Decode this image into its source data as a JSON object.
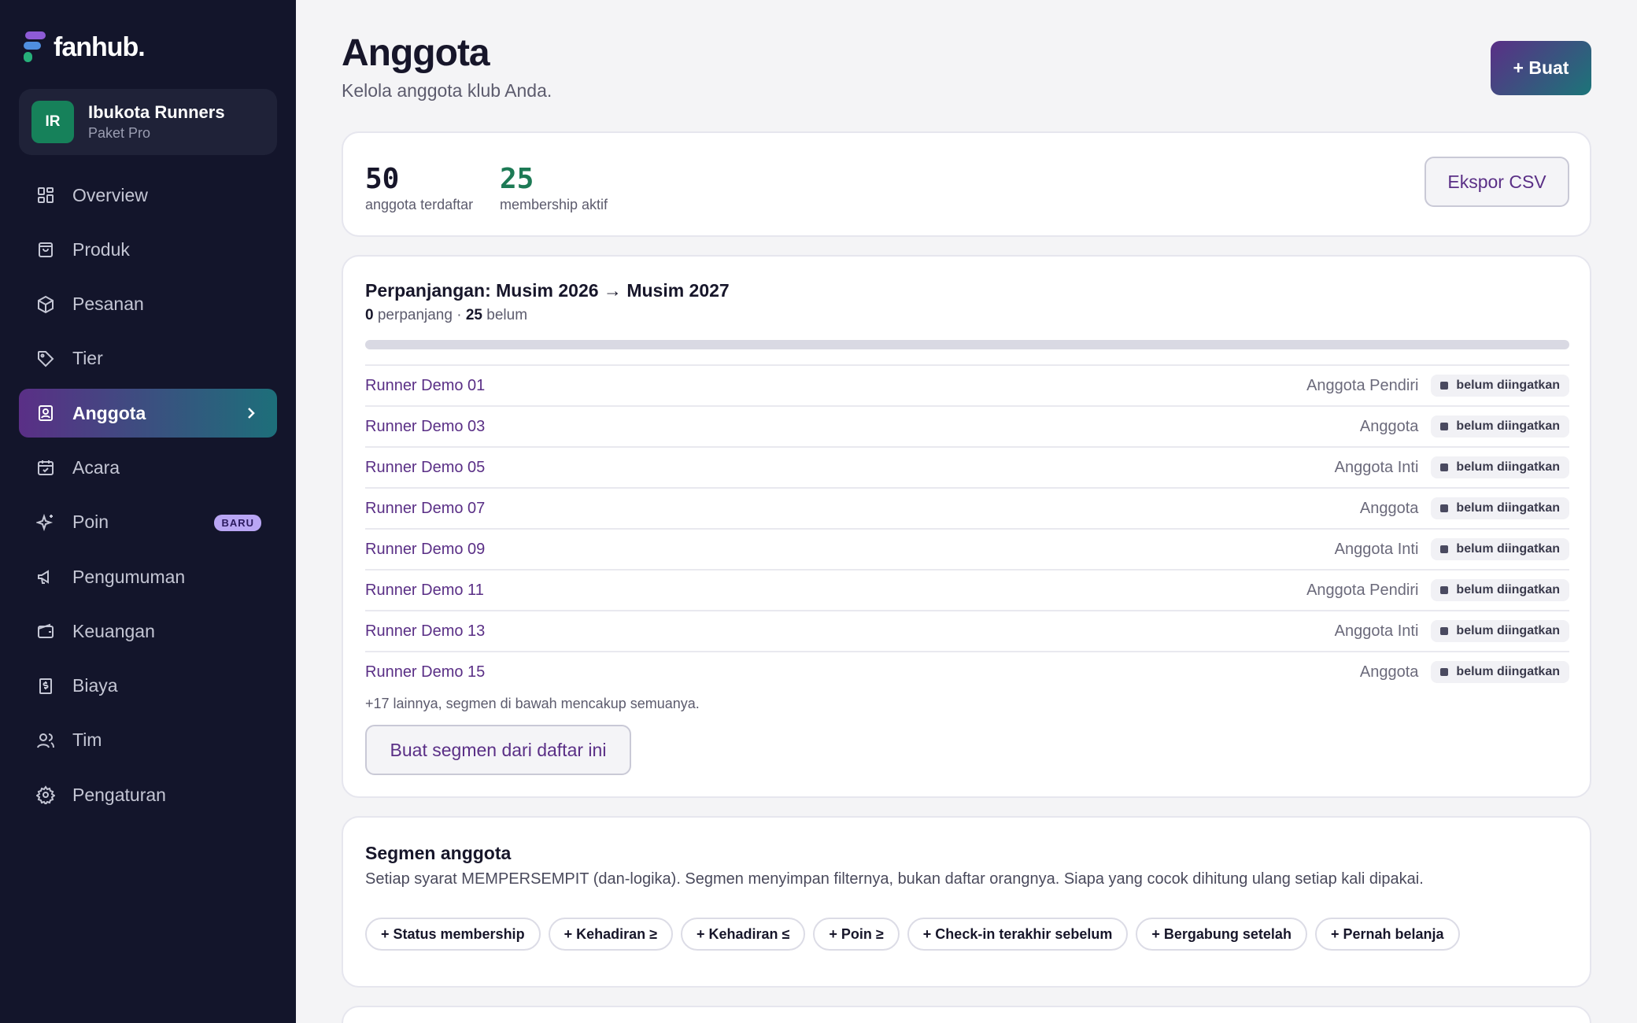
{
  "brand": {
    "name": "fanhub."
  },
  "club": {
    "initials": "IR",
    "name": "Ibukota Runners",
    "plan": "Paket Pro"
  },
  "nav": [
    {
      "label": "Overview",
      "icon": "grid-icon"
    },
    {
      "label": "Produk",
      "icon": "bag-icon"
    },
    {
      "label": "Pesanan",
      "icon": "package-icon"
    },
    {
      "label": "Tier",
      "icon": "tag-icon"
    },
    {
      "label": "Anggota",
      "icon": "member-card-icon",
      "active": true
    },
    {
      "label": "Acara",
      "icon": "calendar-check-icon"
    },
    {
      "label": "Poin",
      "icon": "sparkle-icon",
      "badge": "BARU"
    },
    {
      "label": "Pengumuman",
      "icon": "megaphone-icon"
    },
    {
      "label": "Keuangan",
      "icon": "wallet-icon"
    },
    {
      "label": "Biaya",
      "icon": "receipt-icon"
    },
    {
      "label": "Tim",
      "icon": "users-icon"
    },
    {
      "label": "Pengaturan",
      "icon": "gear-icon"
    }
  ],
  "header": {
    "title": "Anggota",
    "subtitle": "Kelola anggota klub Anda.",
    "create_label": "+ Buat"
  },
  "stats": {
    "registered_value": "50",
    "registered_label": "anggota terdaftar",
    "active_value": "25",
    "active_label": "membership aktif",
    "export_label": "Ekspor CSV",
    "active_color": "#1d7a55"
  },
  "renewal": {
    "title": "Perpanjangan: Musim 2026 → Musim 2027",
    "renewed": "0",
    "renewed_label": "perpanjang ·",
    "pending": "25",
    "pending_label": "belum",
    "progress_fraction": 0,
    "rows": [
      {
        "name": "Runner Demo 01",
        "tier": "Anggota Pendiri",
        "status": "belum diingatkan"
      },
      {
        "name": "Runner Demo 03",
        "tier": "Anggota",
        "status": "belum diingatkan"
      },
      {
        "name": "Runner Demo 05",
        "tier": "Anggota Inti",
        "status": "belum diingatkan"
      },
      {
        "name": "Runner Demo 07",
        "tier": "Anggota",
        "status": "belum diingatkan"
      },
      {
        "name": "Runner Demo 09",
        "tier": "Anggota Inti",
        "status": "belum diingatkan"
      },
      {
        "name": "Runner Demo 11",
        "tier": "Anggota Pendiri",
        "status": "belum diingatkan"
      },
      {
        "name": "Runner Demo 13",
        "tier": "Anggota Inti",
        "status": "belum diingatkan"
      },
      {
        "name": "Runner Demo 15",
        "tier": "Anggota",
        "status": "belum diingatkan"
      }
    ],
    "more_note": "+17 lainnya, segmen di bawah mencakup semuanya.",
    "segment_button": "Buat segmen dari daftar ini"
  },
  "segments": {
    "title": "Segmen anggota",
    "description": "Setiap syarat MEMPERSEMPIT (dan-logika). Segmen menyimpan filternya, bukan daftar orangnya. Siapa yang cocok dihitung ulang setiap kali dipakai.",
    "chips": [
      "+ Status membership",
      "+ Kehadiran ≥",
      "+ Kehadiran ≤",
      "+ Poin ≥",
      "+ Check-in terakhir sebelum",
      "+ Bergabung setelah",
      "+ Pernah belanja"
    ]
  },
  "colors": {
    "accent": "#5a2f86",
    "sidebar": "#13152b",
    "teal": "#1d6f7a"
  }
}
